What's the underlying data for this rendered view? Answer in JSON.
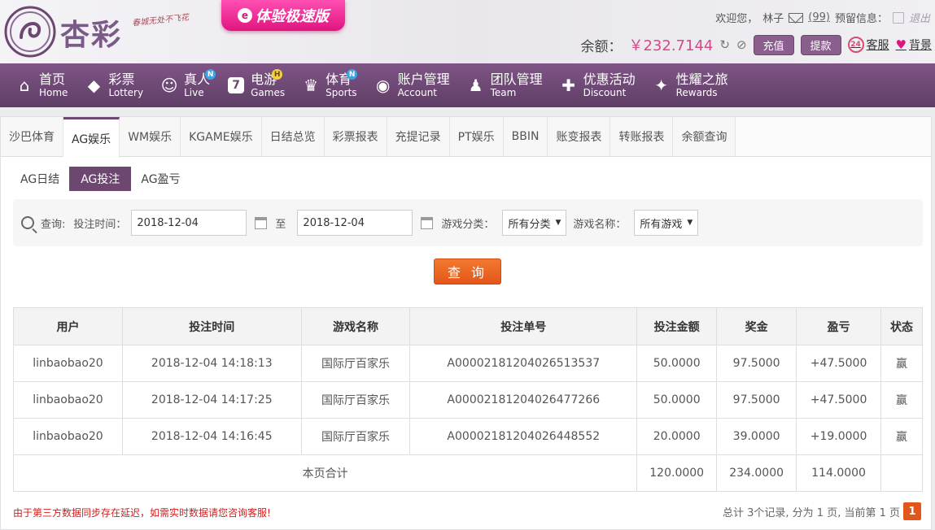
{
  "brand": {
    "logo_text": "杏彩",
    "slogan": "春城无处不飞花",
    "fast_banner": "体验极速版"
  },
  "topbar": {
    "welcome": "欢迎您，",
    "username": "林子",
    "mail_count": "(99)",
    "reserve_label": "预留信息：",
    "logout": "退出"
  },
  "balance": {
    "label": "余额：",
    "value": "￥232.7144",
    "recharge": "充值",
    "withdraw": "提款",
    "service": "客服",
    "background": "背景",
    "service_icon": "24"
  },
  "nav": [
    {
      "cn": "首页",
      "en": "Home",
      "icon": "home-icon",
      "glyph": "⌂",
      "badge": ""
    },
    {
      "cn": "彩票",
      "en": "Lottery",
      "icon": "lottery-icon",
      "glyph": "◆",
      "badge": ""
    },
    {
      "cn": "真人",
      "en": "Live",
      "icon": "live-icon",
      "glyph": "☺",
      "badge": "N"
    },
    {
      "cn": "电游",
      "en": "Games",
      "icon": "games-icon",
      "glyph": "7",
      "badge": "H"
    },
    {
      "cn": "体育",
      "en": "Sports",
      "icon": "trophy-icon",
      "glyph": "♛",
      "badge": "N"
    },
    {
      "cn": "账户管理",
      "en": "Account",
      "icon": "account-icon",
      "glyph": "◉",
      "badge": ""
    },
    {
      "cn": "团队管理",
      "en": "Team",
      "icon": "team-icon",
      "glyph": "♟",
      "badge": ""
    },
    {
      "cn": "优惠活动",
      "en": "Discount",
      "icon": "gift-icon",
      "glyph": "✚",
      "badge": ""
    },
    {
      "cn": "性耀之旅",
      "en": "Rewards",
      "icon": "rewards-icon",
      "glyph": "✦",
      "badge": ""
    }
  ],
  "tabs": [
    "沙巴体育",
    "AG娱乐",
    "WM娱乐",
    "KGAME娱乐",
    "日结总览",
    "彩票报表",
    "充提记录",
    "PT娱乐",
    "BBIN",
    "账变报表",
    "转账报表",
    "余额查询"
  ],
  "active_tab": 1,
  "subtabs": [
    "AG日结",
    "AG投注",
    "AG盈亏"
  ],
  "active_subtab": 1,
  "filter": {
    "query_label": "查询:",
    "time_label": "投注时间：",
    "start_date": "2018-12-04",
    "to_label": "至",
    "end_date": "2018-12-04",
    "category_label": "游戏分类：",
    "category_value": "所有分类",
    "name_label": "游戏名称：",
    "name_value": "所有游戏",
    "query_button": "查 询"
  },
  "table": {
    "headers": [
      "用户",
      "投注时间",
      "游戏名称",
      "投注单号",
      "投注金额",
      "奖金",
      "盈亏",
      "状态"
    ],
    "rows": [
      [
        "linbaobao20",
        "2018-12-04 14:18:13",
        "国际厅百家乐",
        "A00002181204026513537",
        "50.0000",
        "97.5000",
        "+47.5000",
        "赢"
      ],
      [
        "linbaobao20",
        "2018-12-04 14:17:25",
        "国际厅百家乐",
        "A00002181204026477266",
        "50.0000",
        "97.5000",
        "+47.5000",
        "赢"
      ],
      [
        "linbaobao20",
        "2018-12-04 14:16:45",
        "国际厅百家乐",
        "A00002181204026448552",
        "20.0000",
        "39.0000",
        "+19.0000",
        "赢"
      ]
    ],
    "total_label": "本页合计",
    "total_bet": "120.0000",
    "total_prize": "234.0000",
    "total_profit": "114.0000"
  },
  "footer": {
    "note": "由于第三方数据同步存在延迟，如需实时数据请您咨询客服!",
    "summary": "总计 3个记录, 分为 1 页, 当前第 1 页",
    "page": "1"
  },
  "colors": {
    "primary": "#6d4770",
    "accent": "#e4561a",
    "profit": "#1a8a1a",
    "balance": "#d6488a"
  }
}
